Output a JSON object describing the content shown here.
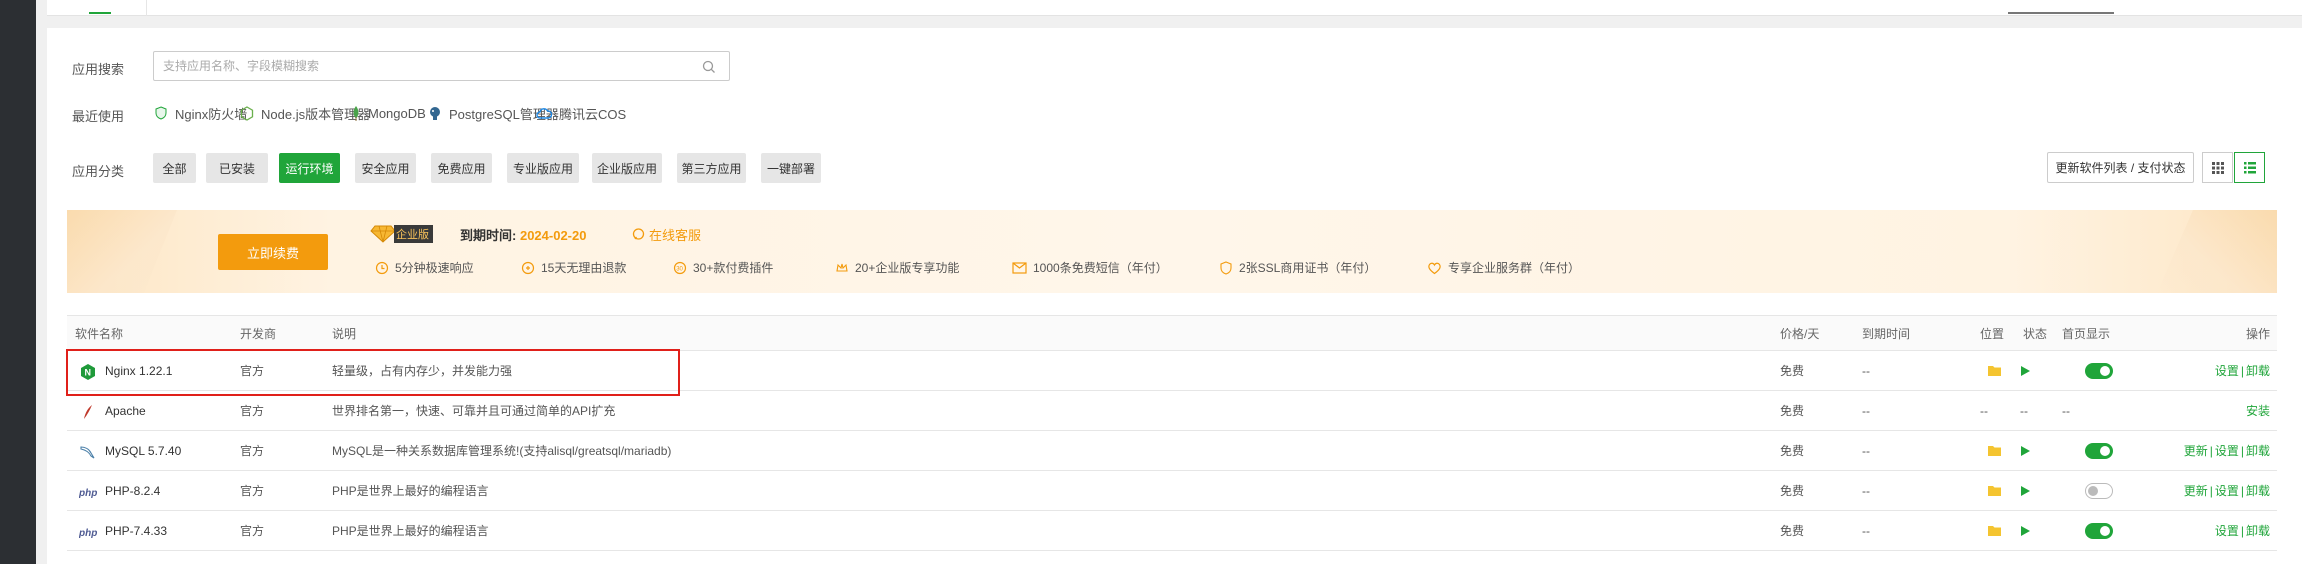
{
  "search": {
    "label": "应用搜索",
    "placeholder": "支持应用名称、字段模糊搜索",
    "value": ""
  },
  "recent": {
    "label": "最近使用",
    "items": [
      {
        "label": "Nginx防火墙",
        "icon": "nginx-waf-icon"
      },
      {
        "label": "Node.js版本管理器",
        "icon": "nodejs-icon"
      },
      {
        "label": "MongoDB",
        "icon": "mongodb-icon"
      },
      {
        "label": "PostgreSQL管理器",
        "icon": "postgresql-icon"
      },
      {
        "label": "腾讯云COS",
        "icon": "tencent-cos-icon"
      }
    ]
  },
  "categories": {
    "label": "应用分类",
    "items": [
      "全部",
      "已安装",
      "运行环境",
      "安全应用",
      "免费应用",
      "专业版应用",
      "企业版应用",
      "第三方应用",
      "一键部署"
    ],
    "active": "运行环境"
  },
  "toolbar": {
    "refresh_label": "更新软件列表 / 支付状态"
  },
  "banner": {
    "renew_label": "立即续费",
    "edition": "企业版",
    "expire_label": "到期时间:",
    "expire_date": "2024-02-20",
    "service_label": "在线客服",
    "features": [
      "5分钟极速响应",
      "15天无理由退款",
      "30+款付费插件",
      "20+企业版专享功能",
      "1000条免费短信（年付）",
      "2张SSL商用证书（年付）",
      "专享企业服务群（年付）"
    ]
  },
  "table": {
    "headers": {
      "name": "软件名称",
      "dev": "开发商",
      "desc": "说明",
      "price": "价格/天",
      "expire": "到期时间",
      "location": "位置",
      "status": "状态",
      "home": "首页显示",
      "ops": "操作"
    },
    "rows": [
      {
        "name": "Nginx 1.22.1",
        "dev": "官方",
        "desc": "轻量级，占有内存少，并发能力强",
        "price": "免费",
        "expire": "--",
        "home_on": true,
        "ops_update": "",
        "ops_settings": "设置",
        "ops_uninstall": "卸载"
      },
      {
        "name": "Apache",
        "dev": "官方",
        "desc": "世界排名第一，快速、可靠并且可通过简单的API扩充",
        "price": "免费",
        "expire": "--",
        "location": "--",
        "status": "--",
        "home": "--",
        "ops_install": "安装"
      },
      {
        "name": "MySQL 5.7.40",
        "dev": "官方",
        "desc": "MySQL是一种关系数据库管理系统!(支持alisql/greatsql/mariadb)",
        "price": "免费",
        "expire": "--",
        "home_on": true,
        "ops_update": "更新",
        "ops_settings": "设置",
        "ops_uninstall": "卸载"
      },
      {
        "name": "PHP-8.2.4",
        "dev": "官方",
        "desc": "PHP是世界上最好的编程语言",
        "price": "免费",
        "expire": "--",
        "home_on": false,
        "ops_update": "更新",
        "ops_settings": "设置",
        "ops_uninstall": "卸载"
      },
      {
        "name": "PHP-7.4.33",
        "dev": "官方",
        "desc": "PHP是世界上最好的编程语言",
        "price": "免费",
        "expire": "--",
        "home_on": true,
        "ops_update": "",
        "ops_settings": "设置",
        "ops_uninstall": "卸载"
      }
    ]
  },
  "colors": {
    "accent": "#20a53a",
    "orange": "#f39b0d",
    "highlight": "#e0201a"
  }
}
